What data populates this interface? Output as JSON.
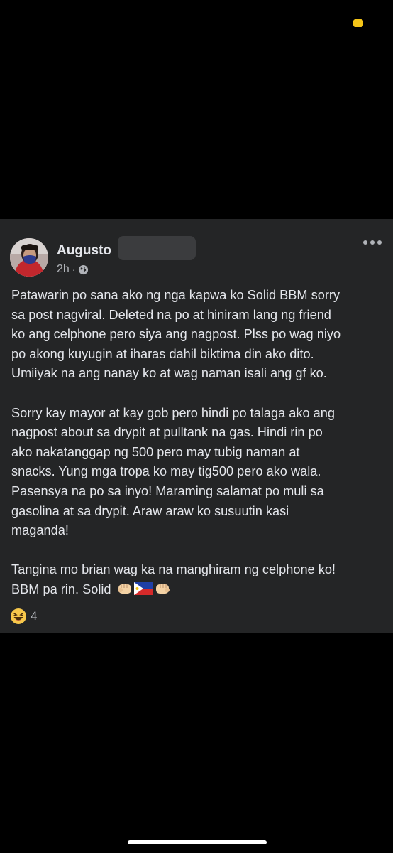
{
  "status": {
    "indicator_color": "#f5c518"
  },
  "post": {
    "author": "Augusto",
    "time": "2h",
    "separator": "·",
    "audience_icon": "globe-icon",
    "more_icon": "more-options-icon",
    "paragraphs": [
      [
        "Patawarin po sana ako ng nga kapwa ko Solid BBM sorry",
        "sa post nagviral. Deleted na po at hiniram lang ng friend",
        "ko ang celphone pero siya ang nagpost. Plss po wag niyo",
        "po akong kuyugin at iharas dahil biktima din ako dito.",
        "Umiiyak na ang nanay ko at wag naman isali ang gf ko."
      ],
      [
        "Sorry kay mayor at kay gob pero hindi po talaga ako ang",
        "nagpost about sa drypit at pulltank na gas. Hindi rin po",
        "ako nakatanggap ng 500 pero may tubig naman at",
        "snacks. Yung mga tropa ko may tig500 pero ako wala.",
        "Pasensya na po sa inyo! Maraming salamat po muli sa",
        "gasolina at sa drypit. Araw araw ko susuutin kasi",
        "maganda!"
      ],
      [
        "Tangina mo brian wag ka na manghiram ng celphone ko!",
        "BBM pa rin. Solid"
      ]
    ],
    "reactions": {
      "icon": "haha-reaction-icon",
      "count": "4"
    }
  }
}
